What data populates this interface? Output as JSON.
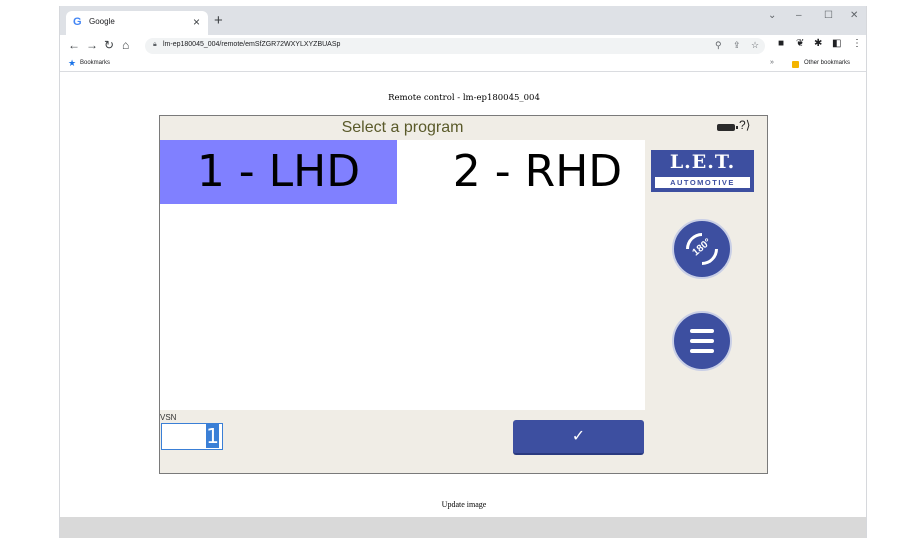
{
  "browser": {
    "tab_title": "Google",
    "tab_close": "×",
    "new_tab": "+",
    "url": "lm-ep180045_004/remote/emSfZGR72WXYLXYZBUASp",
    "bookmarks_label": "Bookmarks",
    "other_bookmarks": "Other bookmarks",
    "chevron": "»"
  },
  "page": {
    "heading": "Remote control - lm-ep180045_004",
    "update_link": "Update image"
  },
  "remote": {
    "title": "Select a program",
    "help": "?",
    "programs": [
      {
        "label": "1 - LHD",
        "selected": true
      },
      {
        "label": "2 - RHD",
        "selected": false
      }
    ],
    "logo_main": "L.E.T.",
    "logo_sub": "AUTOMOTIVE",
    "rotate_label": "180°",
    "vsn_label": "VSN",
    "vsn_value": "1",
    "confirm_icon": "✓",
    "colors": {
      "accent": "#3d4fa0",
      "selected": "#8080ff"
    }
  }
}
